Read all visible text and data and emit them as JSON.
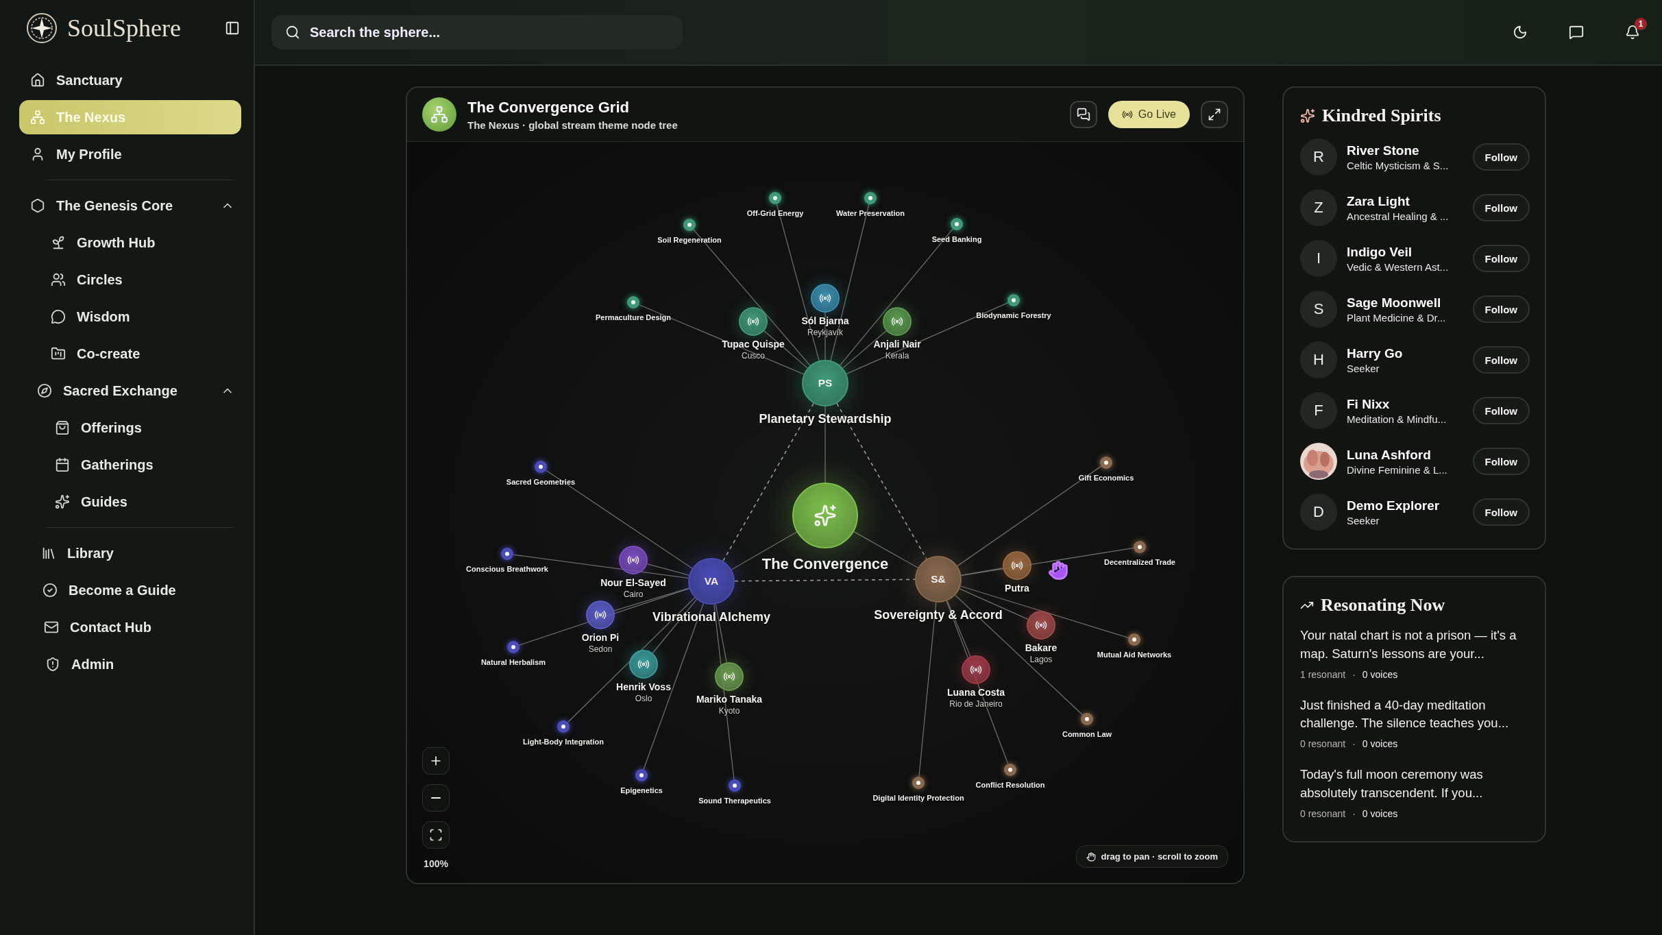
{
  "app": {
    "name": "SoulSphere"
  },
  "sidebar": {
    "items": [
      {
        "label": "Sanctuary",
        "selected": false
      },
      {
        "label": "The Nexus",
        "selected": true
      },
      {
        "label": "My Profile",
        "selected": false
      }
    ],
    "groups": [
      {
        "label": "The Genesis Core",
        "expanded": true,
        "items": [
          {
            "label": "Growth Hub",
            "selected": false
          },
          {
            "label": "Circles",
            "selected": false
          },
          {
            "label": "Wisdom",
            "selected": false
          },
          {
            "label": "Co-create",
            "selected": false
          }
        ]
      },
      {
        "label": "Sacred Exchange",
        "expanded": true,
        "items": [
          {
            "label": "Offerings",
            "selected": false
          },
          {
            "label": "Gatherings",
            "selected": false
          },
          {
            "label": "Guides",
            "selected": false
          }
        ]
      }
    ],
    "links": [
      {
        "label": "Library"
      },
      {
        "label": "Become a Guide"
      },
      {
        "label": "Contact Hub"
      },
      {
        "label": "Admin"
      }
    ]
  },
  "topbar": {
    "search": {
      "placeholder": "Search the sphere..."
    },
    "notifications": "1"
  },
  "grid": {
    "title": "The Convergence Grid",
    "subtitle": "The Nexus · global stream theme node tree",
    "go_live": "Go Live",
    "hub": {
      "label": "The Convergence"
    },
    "themes": [
      {
        "initials": "PS",
        "label": "Planetary Stewardship",
        "color": "#3f9a78",
        "streams": [
          {
            "name": "Tupac Quispe",
            "city": "Cusco",
            "color": "#3f9a78"
          },
          {
            "name": "Sól Bjarna",
            "city": "Reykjavík",
            "color": "#3a8fb0"
          },
          {
            "name": "Anjali Nair",
            "city": "Kerala",
            "color": "#5a9a4e"
          }
        ],
        "topics": [
          "Permaculture Design",
          "Soil Regeneration",
          "Off-Grid Energy",
          "Water Preservation",
          "Seed Banking",
          "Biodynamic Forestry"
        ]
      },
      {
        "initials": "VA",
        "label": "Vibrational Alchemy",
        "color": "#4a4cb8",
        "streams": [
          {
            "name": "Nour El-Sayed",
            "city": "Cairo",
            "color": "#7a4cc0"
          },
          {
            "name": "Orion Pi",
            "city": "Sedon",
            "color": "#5a5cc8"
          },
          {
            "name": "Henrik Voss",
            "city": "Oslo",
            "color": "#3a9a9a"
          },
          {
            "name": "Mariko Tanaka",
            "city": "Kyoto",
            "color": "#6a9a4e"
          }
        ],
        "topics": [
          "Sacred Geometries",
          "Conscious Breathwork",
          "Natural Herbalism",
          "Light-Body Integration",
          "Epigenetics",
          "Sound Therapeutics"
        ]
      },
      {
        "initials": "S&",
        "label": "Sovereignty & Accord",
        "color": "#8a6a4e",
        "streams": [
          {
            "name": "Putra",
            "color": "#9a6a40"
          },
          {
            "name": "Bakare",
            "city": "Lagos",
            "color": "#a04a4a"
          },
          {
            "name": "Luana Costa",
            "city": "Rio de Janeiro",
            "color": "#a03a4a"
          }
        ],
        "topics": [
          "Gift Economics",
          "Decentralized Trade",
          "Mutual Aid Networks",
          "Common Law",
          "Conflict Resolution",
          "Digital Identity Protection"
        ]
      }
    ],
    "zoom": "100%",
    "hint": "drag to pan · scroll to zoom"
  },
  "kindred": {
    "title": "Kindred Spirits",
    "people": [
      {
        "kind": "initial",
        "initial": "R",
        "name": "River Stone",
        "tagline": "Celtic Mysticism & S...",
        "action": "Follow"
      },
      {
        "kind": "initial",
        "initial": "Z",
        "name": "Zara Light",
        "tagline": "Ancestral Healing & ...",
        "action": "Follow"
      },
      {
        "kind": "initial",
        "initial": "I",
        "name": "Indigo Veil",
        "tagline": "Vedic & Western Ast...",
        "action": "Follow"
      },
      {
        "kind": "initial",
        "initial": "S",
        "name": "Sage Moonwell",
        "tagline": "Plant Medicine & Dr...",
        "action": "Follow"
      },
      {
        "kind": "initial",
        "initial": "H",
        "name": "Harry Go",
        "tagline": "Seeker",
        "action": "Follow"
      },
      {
        "kind": "initial",
        "initial": "F",
        "name": "Fi Nixx",
        "tagline": "Meditation & Mindfu...",
        "action": "Follow"
      },
      {
        "kind": "picture",
        "name": "Luna Ashford",
        "tagline": "Divine Feminine & L...",
        "action": "Follow"
      },
      {
        "kind": "initial",
        "initial": "D",
        "name": "Demo Explorer",
        "tagline": "Seeker",
        "action": "Follow"
      }
    ]
  },
  "resonating": {
    "title": "Resonating Now",
    "posts": [
      {
        "text": "Your natal chart is not a prison — it's a map. Saturn's lessons are your...",
        "resonant": "1 resonant",
        "separator": "·",
        "voices": "0 voices"
      },
      {
        "text": "Just finished a 40-day meditation challenge. The silence teaches you...",
        "resonant": "0 resonant",
        "separator": "·",
        "voices": "0 voices"
      },
      {
        "text": "Today's full moon ceremony was absolutely transcendent. If you...",
        "resonant": "0 resonant",
        "separator": "·",
        "voices": "0 voices"
      }
    ]
  }
}
